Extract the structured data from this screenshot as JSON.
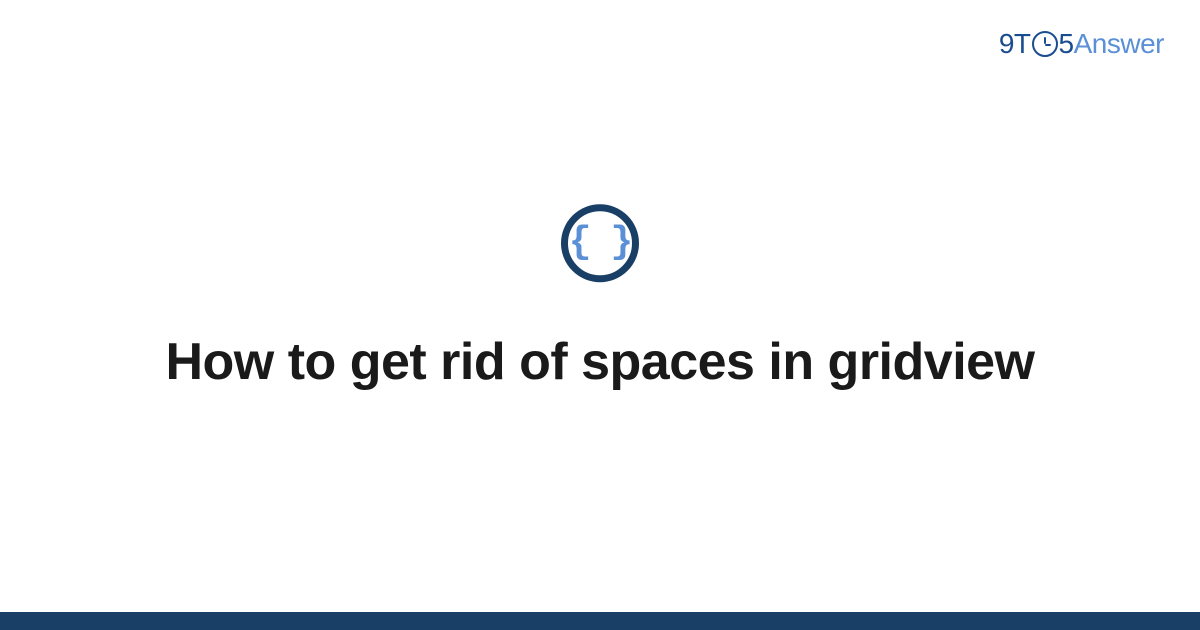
{
  "logo": {
    "part1": "9T",
    "part2": "5",
    "part3": "Answer"
  },
  "icon": {
    "braces": "{ }"
  },
  "title": "How to get rid of spaces in gridview",
  "colors": {
    "brand_dark": "#1a3f66",
    "brand_blue": "#1a4d8f",
    "brand_light": "#5b8fd6"
  }
}
